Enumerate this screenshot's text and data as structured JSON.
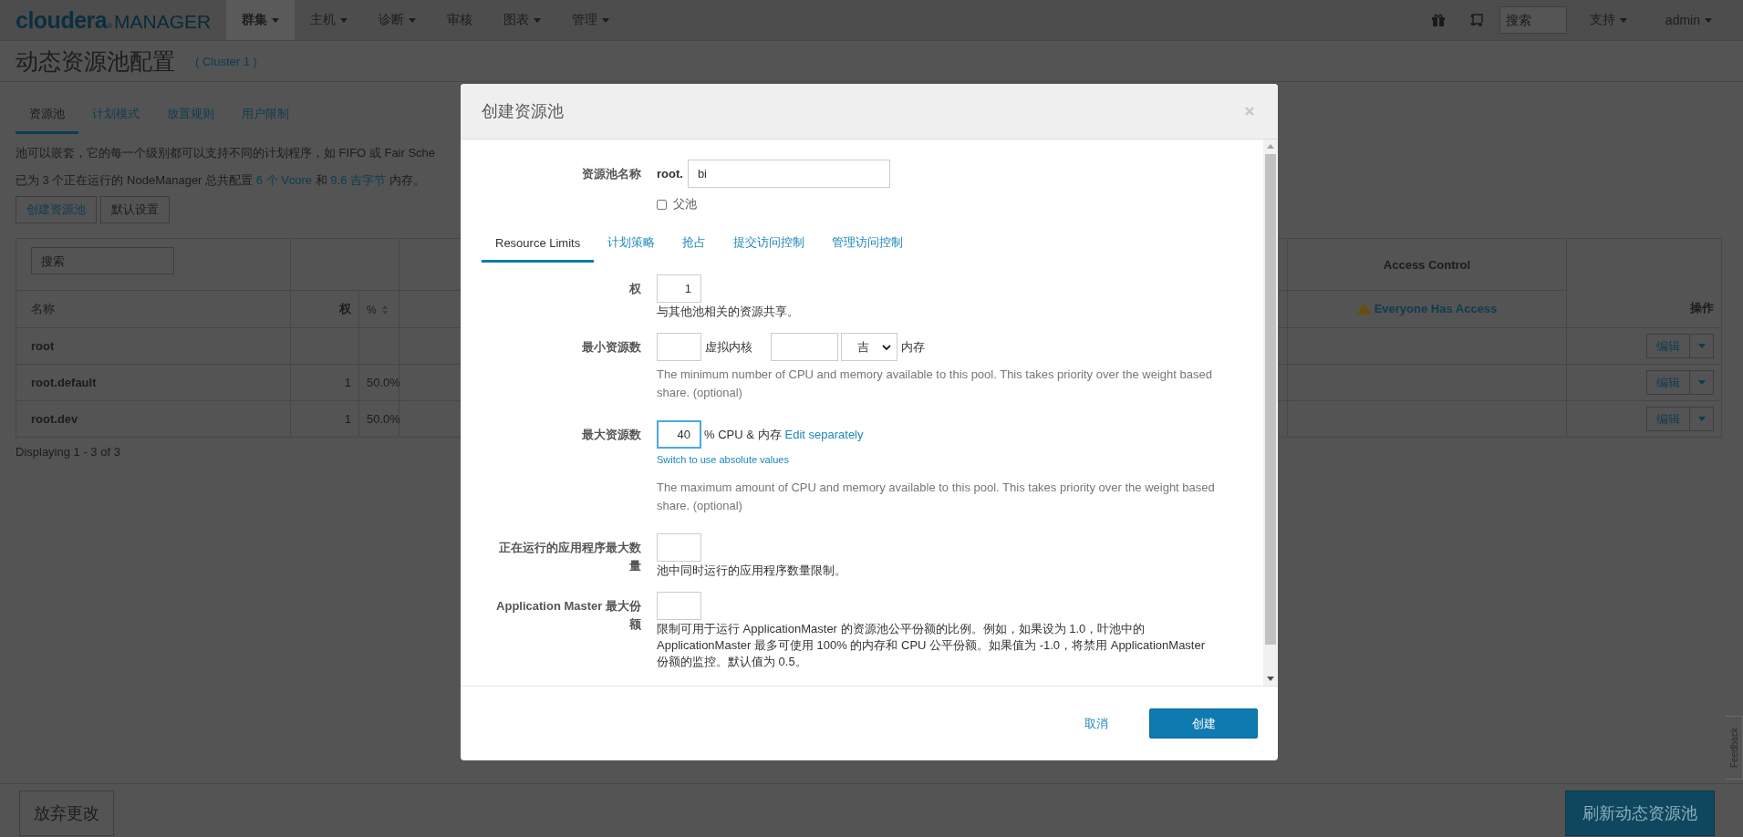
{
  "navbar": {
    "logo_brand": "cloudera",
    "logo_mark": "®",
    "logo_product": "MANAGER",
    "menu": [
      {
        "label": "群集",
        "selected": true,
        "dropdown": true
      },
      {
        "label": "主机",
        "selected": false,
        "dropdown": true
      },
      {
        "label": "诊断",
        "selected": false,
        "dropdown": true
      },
      {
        "label": "审核",
        "selected": false,
        "dropdown": false
      },
      {
        "label": "图表",
        "selected": false,
        "dropdown": true
      },
      {
        "label": "管理",
        "selected": false,
        "dropdown": true
      }
    ],
    "search": {
      "placeholder": "搜索"
    },
    "right_menu": [
      {
        "label": "支持"
      },
      {
        "label": "admin"
      }
    ]
  },
  "page": {
    "title": "动态资源池配置",
    "cluster": "( Cluster 1 )"
  },
  "tabs": [
    {
      "label": "资源池",
      "selected": true
    },
    {
      "label": "计划模式",
      "selected": false
    },
    {
      "label": "放置规则",
      "selected": false
    },
    {
      "label": "用户限制",
      "selected": false
    }
  ],
  "intro": "池可以嵌套，它的每一个级别都可以支持不同的计划程序，如 FIFO 或 Fair Sche",
  "summary": [
    {
      "kind": "text",
      "text": "已为 3 个正在运行的 NodeManager 总共配置 "
    },
    {
      "kind": "link",
      "text": "6 个 Vcore"
    },
    {
      "kind": "text",
      "text": " 和 "
    },
    {
      "kind": "link",
      "text": "9.6 吉字节"
    },
    {
      "kind": "text",
      "text": " 内存。"
    }
  ],
  "buttons": [
    {
      "label": "创建资源池",
      "kind": "link"
    },
    {
      "label": "默认设置",
      "kind": "plain"
    }
  ],
  "table": {
    "search": {
      "placeholder": "搜索"
    },
    "group_header": "Access Control",
    "columns": {
      "name": "名称",
      "weight": "权",
      "percent": "%",
      "access": "Everyone Has Access",
      "actions": "操作"
    },
    "rows": [
      {
        "name": "root",
        "action": "编辑"
      },
      {
        "name": "root.default",
        "weight": "1",
        "percent": "50.0%",
        "action": "编辑"
      },
      {
        "name": "root.dev",
        "weight": "1",
        "percent": "50.0%",
        "action": "编辑"
      }
    ]
  },
  "pagination": "Displaying 1 - 3 of 3",
  "bottom_bar": {
    "discard": "放弃更改",
    "refresh": "刷新动态资源池"
  },
  "feedback": "Feedback",
  "modal": {
    "title": "创建资源池",
    "name_row": {
      "label": "资源池名称",
      "prefix": "root.",
      "value": "bi",
      "checkbox": {
        "label": "父池",
        "checked": false
      }
    },
    "tabs": [
      {
        "label": "Resource Limits",
        "selected": true
      },
      {
        "label": "计划策略",
        "selected": false
      },
      {
        "label": "抢占",
        "selected": false
      },
      {
        "label": "提交访问控制",
        "selected": false
      },
      {
        "label": "管理访问控制",
        "selected": false
      }
    ],
    "rows": [
      {
        "kind": "single",
        "label": "权",
        "value": "1",
        "hint": "与其他池相关的资源共享。"
      },
      {
        "kind": "min",
        "label": "最小资源数",
        "cpu_unit": "虚拟内核",
        "mem_select": "吉",
        "mem_unit": "内存",
        "help": "The minimum number of CPU and memory available to this pool. This takes priority over the weight based share. (optional)"
      },
      {
        "kind": "max",
        "label": "最大资源数",
        "value": "40",
        "focused": true,
        "unit": "% CPU & 内存",
        "link": "Edit separately",
        "switch_link": "Switch to use absolute values",
        "help": "The maximum amount of CPU and memory available to this pool. This takes priority over the weight based share. (optional)"
      },
      {
        "kind": "single",
        "label": "正在运行的应用程序最大数量",
        "hint": "池中同时运行的应用程序数量限制。"
      },
      {
        "kind": "single",
        "label": "Application Master 最大份额",
        "hint": "限制可用于运行 ApplicationMaster 的资源池公平份额的比例。例如，如果设为 1.0，叶池中的 ApplicationMaster 最多可使用 100% 的内存和 CPU 公平份额。如果值为 -1.0，将禁用 ApplicationMaster 份额的监控。默认值为 0.5。"
      }
    ],
    "cancel": "取消",
    "create": "创建"
  }
}
